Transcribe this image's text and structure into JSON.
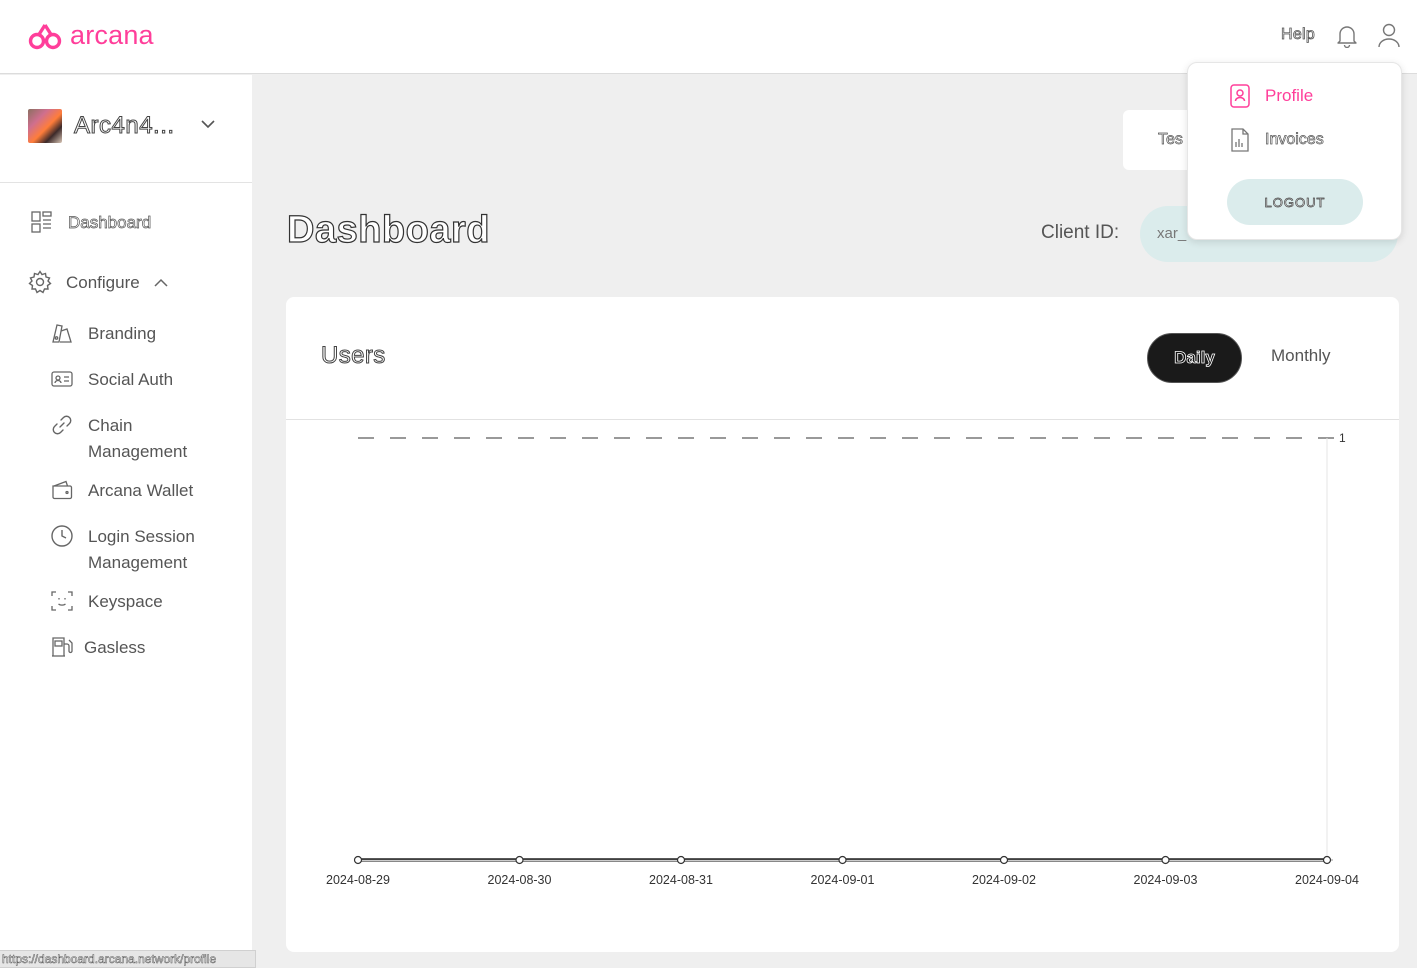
{
  "header": {
    "logo_text": "arcana",
    "help_label": "Help",
    "brand_color": "#ff3e9a"
  },
  "sidebar": {
    "app_name": "Arc4n4...",
    "items": [
      {
        "label": "Dashboard",
        "icon": "dashboard-icon"
      },
      {
        "label": "Configure",
        "icon": "gear-icon"
      }
    ],
    "configure_items": [
      {
        "label": "Branding",
        "icon": "brush-icon"
      },
      {
        "label": "Social Auth",
        "icon": "id-card-icon"
      },
      {
        "label": "Chain Management",
        "line1": "Chain",
        "line2": "Management",
        "icon": "link-icon"
      },
      {
        "label": "Arcana Wallet",
        "icon": "wallet-icon"
      },
      {
        "label": "Login Session Management",
        "line1": "Login Session",
        "line2": "Management",
        "icon": "clock-icon"
      },
      {
        "label": "Keyspace",
        "icon": "face-scan-icon"
      },
      {
        "label": "Gasless",
        "icon": "fuel-pump-icon"
      }
    ]
  },
  "main": {
    "tab_partial": "Tes",
    "title": "Dashboard",
    "client_id_label": "Client ID:",
    "client_id_value": "xar_",
    "users_card": {
      "title": "Users",
      "toggle_daily": "Daily",
      "toggle_monthly": "Monthly"
    }
  },
  "menu": {
    "profile_label": "Profile",
    "invoices_label": "Invoices",
    "logout_label": "LOGOUT"
  },
  "status_bar": {
    "url": "https://dashboard.arcana.network/profile"
  },
  "chart_data": {
    "type": "line",
    "categories": [
      "2024-08-29",
      "2024-08-30",
      "2024-08-31",
      "2024-09-01",
      "2024-09-02",
      "2024-09-03",
      "2024-09-04"
    ],
    "series": [
      {
        "values": [
          0,
          0,
          0,
          0,
          0,
          0,
          0
        ]
      }
    ],
    "y_tick_labels": [
      "1"
    ],
    "ylim": [
      0,
      1
    ],
    "grid": "dashed line at y = 1",
    "title": "",
    "xlabel": "",
    "ylabel": ""
  }
}
